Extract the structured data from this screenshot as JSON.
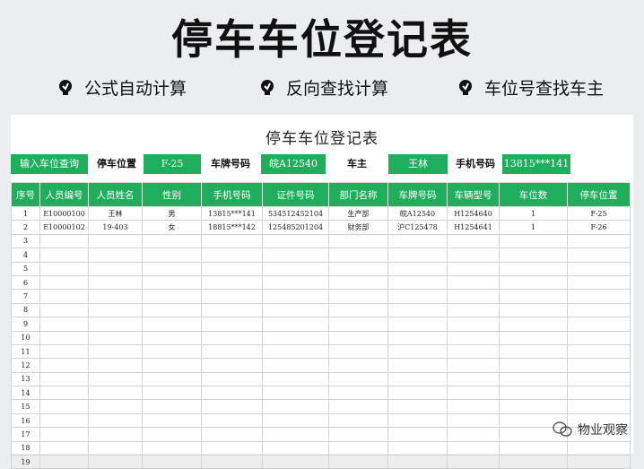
{
  "banner": {
    "title": "停车车位登记表",
    "features": [
      "公式自动计算",
      "反向查找计算",
      "车位号查找车主"
    ]
  },
  "sheet": {
    "title": "停车车位登记表",
    "query": {
      "button_label": "输入车位查询",
      "parking_label": "停车位置",
      "parking_value": "F-25",
      "plate_label": "车牌号码",
      "plate_value": "皖A12540",
      "owner_label": "车主",
      "owner_value": "王林",
      "phone_label": "手机号码",
      "phone_value": "13815***141"
    },
    "columns": [
      "序号",
      "人员编号",
      "人员姓名",
      "性别",
      "手机号码",
      "证件号码",
      "部门名称",
      "车牌号码",
      "车辆型号",
      "车位数",
      "停车位置"
    ],
    "rows": [
      [
        "1",
        "E10000100",
        "王林",
        "男",
        "13815***141",
        "534512452104",
        "生产部",
        "皖A12540",
        "H1254640",
        "1",
        "F-25"
      ],
      [
        "2",
        "E10000102",
        "19-403",
        "女",
        "18815***142",
        "125485201204",
        "财务部",
        "沪C125478",
        "H1254641",
        "1",
        "F-26"
      ],
      [
        "3"
      ],
      [
        "4"
      ],
      [
        "5"
      ],
      [
        "6"
      ],
      [
        "7"
      ],
      [
        "8"
      ],
      [
        "9"
      ],
      [
        "10"
      ],
      [
        "11"
      ],
      [
        "12"
      ],
      [
        "13"
      ],
      [
        "14"
      ],
      [
        "15"
      ],
      [
        "16"
      ],
      [
        "17"
      ],
      [
        "18"
      ],
      [
        "19"
      ]
    ]
  },
  "watermark": {
    "text": "物业观察"
  },
  "colors": {
    "accent": "#1fae5b",
    "background": "#ebedf1"
  },
  "icons": [
    "bulb-icon",
    "wechat-icon"
  ]
}
